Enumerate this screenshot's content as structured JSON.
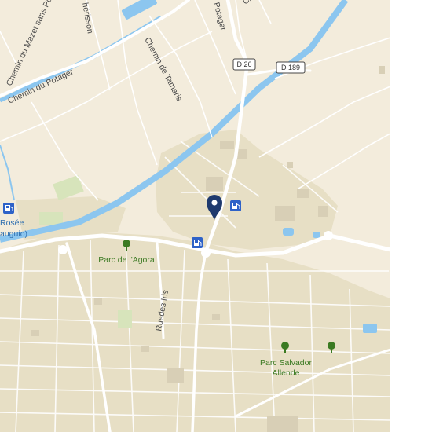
{
  "map": {
    "colors": {
      "land": "#f3ecdc",
      "urban": "#e6dfc6",
      "canal": "#8cc6ef",
      "road": "#ffffff",
      "park_text": "#3b7a22",
      "poi": "#2e62c8",
      "pin": "#1f3a6e"
    },
    "street_labels": {
      "mazet": "Chemin du Mazet sans Porc",
      "herisson": "hérisson",
      "potager_top": "Potager",
      "chem_top": "Chem",
      "potager_left": "Chemin du Potager",
      "tamaris": "Chemin de Tamaris",
      "iris": "Ruedes Iris"
    },
    "shields": {
      "d26": "D 26",
      "d189": "D 189"
    },
    "place_labels": {
      "rosee": "Rosée",
      "mauguio": "auguio)",
      "agora": "Parc de l'Agora",
      "salvador_1": "Parc Salvador",
      "salvador_2": "Allende"
    },
    "icons": {
      "fuel": "fuel-station-icon",
      "tree": "park-tree-icon",
      "pin": "location-pin-icon"
    }
  }
}
